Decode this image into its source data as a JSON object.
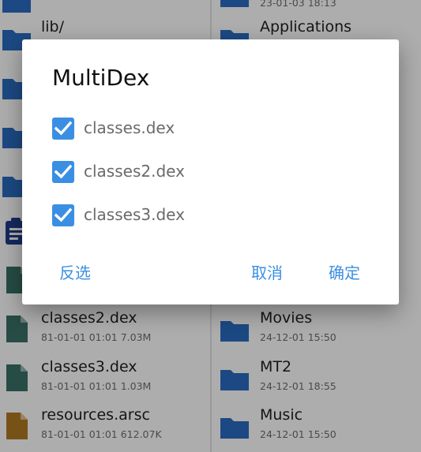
{
  "colors": {
    "accent": "#3b8fe2",
    "folder": "#2a6cc2",
    "dex_file": "#3a6f66",
    "arsc_file": "#b07a22",
    "clipboard": "#1f3d8a",
    "scrim": "rgba(0,0,0,0.32)"
  },
  "left_pane": {
    "items": [
      {
        "icon": "folder-icon",
        "name": "",
        "meta": ""
      },
      {
        "icon": "folder-icon",
        "name": "lib/",
        "meta": ""
      },
      {
        "icon": "folder-icon",
        "name": "",
        "meta": ""
      },
      {
        "icon": "folder-icon",
        "name": "",
        "meta": ""
      },
      {
        "icon": "folder-icon",
        "name": "",
        "meta": ""
      },
      {
        "icon": "clipboard-icon",
        "name": "",
        "meta": ""
      },
      {
        "icon": "dex-file-icon",
        "name": "",
        "meta": ""
      },
      {
        "icon": "dex-file-icon",
        "name": "classes2.dex",
        "meta": "81-01-01 01:01  7.03M"
      },
      {
        "icon": "dex-file-icon",
        "name": "classes3.dex",
        "meta": "81-01-01 01:01  1.03M"
      },
      {
        "icon": "arsc-file-icon",
        "name": "resources.arsc",
        "meta": "81-01-01 01:01  612.07K"
      }
    ]
  },
  "right_pane": {
    "items": [
      {
        "icon": "folder-icon",
        "name": "",
        "meta": "23-01-03 18:13"
      },
      {
        "icon": "folder-icon",
        "name": "Applications",
        "meta": ""
      },
      {
        "icon": "folder-icon",
        "name": "Movies",
        "meta": "24-12-01 15:50"
      },
      {
        "icon": "folder-icon",
        "name": "MT2",
        "meta": "24-12-01 18:55"
      },
      {
        "icon": "folder-icon",
        "name": "Music",
        "meta": "24-12-01 15:50"
      }
    ]
  },
  "dialog": {
    "title": "MultiDex",
    "options": [
      {
        "label": "classes.dex",
        "checked": true
      },
      {
        "label": "classes2.dex",
        "checked": true
      },
      {
        "label": "classes3.dex",
        "checked": true
      }
    ],
    "invert_label": "反选",
    "cancel_label": "取消",
    "ok_label": "确定"
  }
}
